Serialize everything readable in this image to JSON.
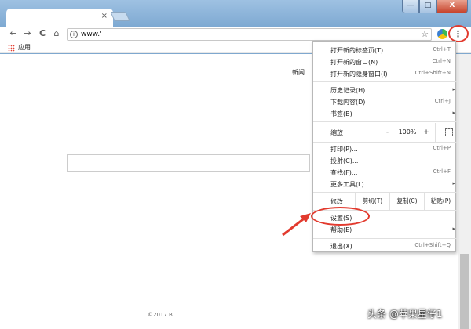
{
  "browser": {
    "tab_close": "×",
    "address_url": "www.'",
    "info_icon_glyph": "i",
    "star_glyph": "☆",
    "back_glyph": "←",
    "forward_glyph": "→",
    "reload_glyph": "C",
    "home_glyph": "⌂",
    "menu_glyph": "⋮",
    "window_min": "—",
    "window_max": "□",
    "window_close": "X"
  },
  "bookmarks": {
    "apps_label": "应用"
  },
  "page": {
    "news_link": "新闻",
    "footer": "©2017 B"
  },
  "menu": {
    "items_top": [
      {
        "label": "打开新的标签页(T)",
        "shortcut": "Ctrl+T"
      },
      {
        "label": "打开新的窗口(N)",
        "shortcut": "Ctrl+N"
      },
      {
        "label": "打开新的隐身窗口(I)",
        "shortcut": "Ctrl+Shift+N"
      }
    ],
    "items_history": [
      {
        "label": "历史记录(H)",
        "shortcut": "",
        "arrow": "▸"
      },
      {
        "label": "下载内容(D)",
        "shortcut": "Ctrl+J",
        "arrow": ""
      },
      {
        "label": "书签(B)",
        "shortcut": "",
        "arrow": "▸"
      }
    ],
    "zoom": {
      "label": "缩放",
      "minus": "-",
      "value": "100%",
      "plus": "+"
    },
    "items_tools": [
      {
        "label": "打印(P)...",
        "shortcut": "Ctrl+P",
        "arrow": ""
      },
      {
        "label": "投射(C)...",
        "shortcut": "",
        "arrow": ""
      },
      {
        "label": "查找(F)...",
        "shortcut": "Ctrl+F",
        "arrow": ""
      },
      {
        "label": "更多工具(L)",
        "shortcut": "",
        "arrow": "▸"
      }
    ],
    "edit": {
      "label": "修改",
      "cut": "剪切(T)",
      "copy": "复制(C)",
      "paste": "粘贴(P)"
    },
    "items_settings": [
      {
        "label": "设置(S)",
        "shortcut": "",
        "arrow": ""
      },
      {
        "label": "帮助(E)",
        "shortcut": "",
        "arrow": "▸"
      }
    ],
    "exit": {
      "label": "退出(X)",
      "shortcut": "Ctrl+Shift+Q"
    }
  },
  "watermark": "头条 @苹果星仔1",
  "colors": {
    "highlight_circle": "#e23a2e",
    "titlebar": "#7ea9d2"
  }
}
